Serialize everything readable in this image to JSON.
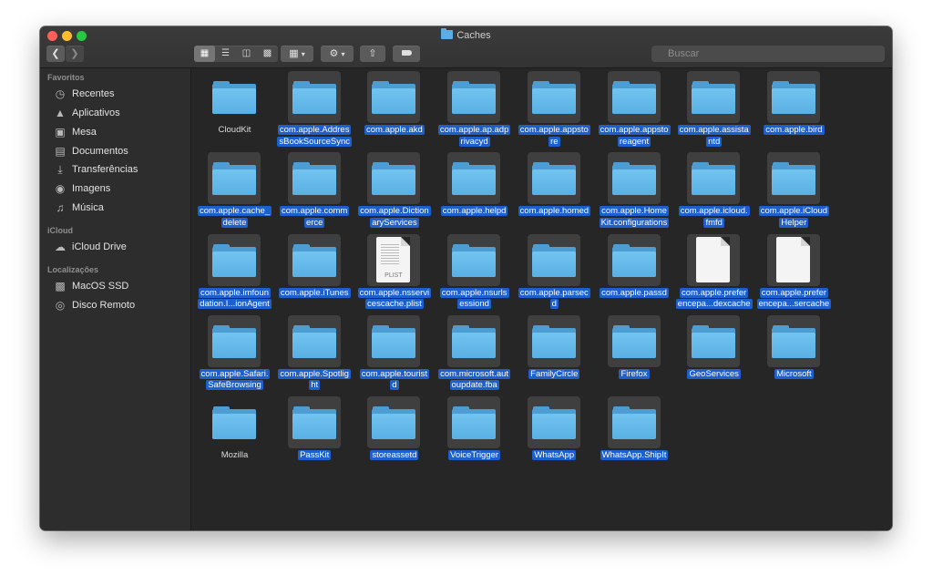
{
  "window": {
    "title": "Caches"
  },
  "toolbar": {
    "back_icon": "chevron-left-icon",
    "forward_icon": "chevron-right-icon",
    "view_icons": "grid-icon",
    "view_list": "list-icon",
    "view_columns": "columns-icon",
    "view_gallery": "gallery-icon",
    "group_icon": "group-grid-icon",
    "action_icon": "gear-icon",
    "share_icon": "share-icon",
    "tag_icon": "tag-icon"
  },
  "search": {
    "placeholder": "Buscar"
  },
  "sidebar": {
    "favorites_header": "Favoritos",
    "favorites": [
      {
        "label": "Recentes",
        "icon": "clock-icon"
      },
      {
        "label": "Aplicativos",
        "icon": "applications-icon"
      },
      {
        "label": "Mesa",
        "icon": "desktop-icon"
      },
      {
        "label": "Documentos",
        "icon": "document-icon"
      },
      {
        "label": "Transferências",
        "icon": "download-icon"
      },
      {
        "label": "Imagens",
        "icon": "camera-icon"
      },
      {
        "label": "Música",
        "icon": "music-icon"
      }
    ],
    "icloud_header": "iCloud",
    "icloud": [
      {
        "label": "iCloud Drive",
        "icon": "cloud-icon"
      }
    ],
    "locations_header": "Localizações",
    "locations": [
      {
        "label": "MacOS SSD",
        "icon": "drive-icon"
      },
      {
        "label": "Disco Remoto",
        "icon": "disc-icon"
      }
    ]
  },
  "files": [
    {
      "lines": [
        "CloudKit"
      ],
      "type": "folder",
      "selected": false
    },
    {
      "lines": [
        "com.apple.Addres",
        "sBookSourceSync"
      ],
      "type": "folder",
      "selected": true
    },
    {
      "lines": [
        "com.apple.akd"
      ],
      "type": "folder",
      "selected": true
    },
    {
      "lines": [
        "com.apple.ap.adp",
        "rivacyd"
      ],
      "type": "folder",
      "selected": true
    },
    {
      "lines": [
        "com.apple.appsto",
        "re"
      ],
      "type": "folder",
      "selected": true
    },
    {
      "lines": [
        "com.apple.appsto",
        "reagent"
      ],
      "type": "folder",
      "selected": true
    },
    {
      "lines": [
        "com.apple.assista",
        "ntd"
      ],
      "type": "folder",
      "selected": true
    },
    {
      "lines": [
        "com.apple.bird"
      ],
      "type": "folder",
      "selected": true
    },
    {
      "lines": [
        "com.apple.cache_",
        "delete"
      ],
      "type": "folder",
      "selected": true
    },
    {
      "lines": [
        "com.apple.comm",
        "erce"
      ],
      "type": "folder",
      "selected": true
    },
    {
      "lines": [
        "com.apple.Diction",
        "aryServices"
      ],
      "type": "folder",
      "selected": true
    },
    {
      "lines": [
        "com.apple.helpd"
      ],
      "type": "folder",
      "selected": true
    },
    {
      "lines": [
        "com.apple.homed"
      ],
      "type": "folder",
      "selected": true
    },
    {
      "lines": [
        "com.apple.Home",
        "Kit.configurations"
      ],
      "type": "folder",
      "selected": true
    },
    {
      "lines": [
        "com.apple.icloud.",
        "fmfd"
      ],
      "type": "folder",
      "selected": true
    },
    {
      "lines": [
        "com.apple.iCloud",
        "Helper"
      ],
      "type": "folder",
      "selected": true
    },
    {
      "lines": [
        "com.apple.imfoun",
        "dation.I...ionAgent"
      ],
      "type": "folder",
      "selected": true
    },
    {
      "lines": [
        "com.apple.iTunes"
      ],
      "type": "folder",
      "selected": true
    },
    {
      "lines": [
        "com.apple.nsservi",
        "cescache.plist"
      ],
      "type": "plist",
      "ext": "PLIST",
      "selected": true
    },
    {
      "lines": [
        "com.apple.nsurls",
        "essiond"
      ],
      "type": "folder",
      "selected": true
    },
    {
      "lines": [
        "com.apple.parsec",
        "d"
      ],
      "type": "folder",
      "selected": true
    },
    {
      "lines": [
        "com.apple.passd"
      ],
      "type": "folder",
      "selected": true
    },
    {
      "lines": [
        "com.apple.prefer",
        "encepa...dexcache"
      ],
      "type": "doc",
      "selected": true
    },
    {
      "lines": [
        "com.apple.prefer",
        "encepa...sercache"
      ],
      "type": "doc",
      "selected": true
    },
    {
      "lines": [
        "com.apple.Safari.",
        "SafeBrowsing"
      ],
      "type": "folder",
      "selected": true
    },
    {
      "lines": [
        "com.apple.Spotlig",
        "ht"
      ],
      "type": "folder",
      "selected": true
    },
    {
      "lines": [
        "com.apple.tourist",
        "d"
      ],
      "type": "folder",
      "selected": true
    },
    {
      "lines": [
        "com.microsoft.aut",
        "oupdate.fba"
      ],
      "type": "folder",
      "selected": true
    },
    {
      "lines": [
        "FamilyCircle"
      ],
      "type": "folder",
      "selected": true
    },
    {
      "lines": [
        "Firefox"
      ],
      "type": "folder",
      "selected": true
    },
    {
      "lines": [
        "GeoServices"
      ],
      "type": "folder",
      "selected": true
    },
    {
      "lines": [
        "Microsoft"
      ],
      "type": "folder",
      "selected": true
    },
    {
      "lines": [
        "Mozilla"
      ],
      "type": "folder",
      "selected": false
    },
    {
      "lines": [
        "PassKit"
      ],
      "type": "folder",
      "selected": true
    },
    {
      "lines": [
        "storeassetd"
      ],
      "type": "folder",
      "selected": true
    },
    {
      "lines": [
        "VoiceTrigger"
      ],
      "type": "folder",
      "selected": true
    },
    {
      "lines": [
        "WhatsApp"
      ],
      "type": "folder",
      "selected": true
    },
    {
      "lines": [
        "WhatsApp.ShipIt"
      ],
      "type": "folder",
      "selected": true
    }
  ]
}
